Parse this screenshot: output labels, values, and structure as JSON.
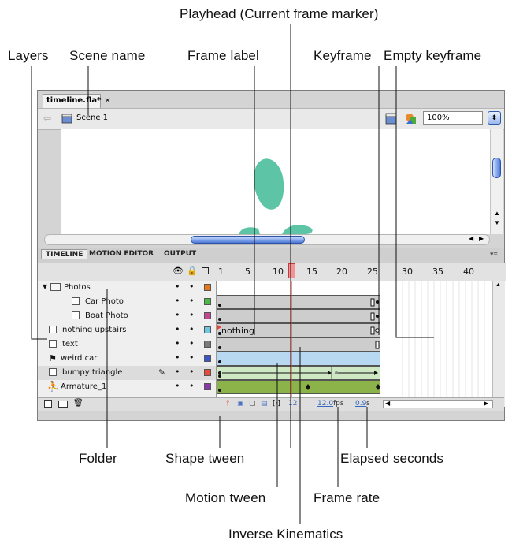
{
  "callouts": {
    "playhead": "Playhead (Current frame marker)",
    "layers": "Layers",
    "scene_name": "Scene name",
    "frame_label": "Frame label",
    "keyframe": "Keyframe",
    "empty_keyframe": "Empty keyframe",
    "folder": "Folder",
    "shape_tween": "Shape tween",
    "elapsed_seconds": "Elapsed seconds",
    "motion_tween": "Motion tween",
    "frame_rate": "Frame rate",
    "inverse_kinematics": "Inverse Kinematics"
  },
  "window": {
    "doc_tab": "timeline.fla*",
    "doc_tab_close": "×",
    "scene": "Scene 1",
    "zoom": "100%"
  },
  "panel_tabs": [
    "TIMELINE",
    "MOTION EDITOR",
    "OUTPUT"
  ],
  "ruler": [
    "1",
    "5",
    "10",
    "15",
    "20",
    "25",
    "30",
    "35",
    "40"
  ],
  "layers": [
    {
      "name": "Photos",
      "type": "folder",
      "color": "#e8781e"
    },
    {
      "name": "Car Photo",
      "type": "layer",
      "color": "#4cb848"
    },
    {
      "name": "Boat Photo",
      "type": "layer",
      "color": "#c0468f"
    },
    {
      "name": "nothing upstairs",
      "type": "layer",
      "color": "#6fc6df"
    },
    {
      "name": "text",
      "type": "layer",
      "color": "#7a7a7a"
    },
    {
      "name": "weird car",
      "type": "guide",
      "color": "#3a56c8"
    },
    {
      "name": "bumpy triangle",
      "type": "layer",
      "color": "#e84a3a"
    },
    {
      "name": "Armature_1",
      "type": "armature",
      "color": "#8a3aa8"
    }
  ],
  "frame_label_text": "nothing",
  "status": {
    "frame": "12",
    "fps": "12.0",
    "fps_unit": "fps",
    "elapsed": "0.9",
    "elapsed_unit": "s"
  },
  "tween_colors": {
    "shape": "#cfe8c4",
    "motion": "#b8d8f2",
    "ik": "#8cb34a",
    "playhead": "#e8443a"
  }
}
